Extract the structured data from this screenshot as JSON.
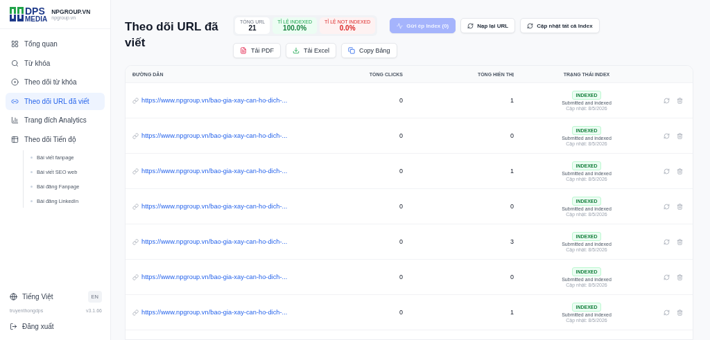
{
  "brand": {
    "logo_top": "DPS",
    "logo_bottom": "MEDIA",
    "name": "NPGROUP.VN",
    "domain": "npgroup.vn"
  },
  "nav": [
    {
      "label": "Tổng quan",
      "selected": false
    },
    {
      "label": "Từ khóa",
      "selected": false
    },
    {
      "label": "Theo dõi từ khóa",
      "selected": false
    },
    {
      "label": "Theo dõi URL đã viết",
      "selected": true
    },
    {
      "label": "Trang đích Analytics",
      "selected": false
    },
    {
      "label": "Theo dõi Tiến độ",
      "selected": false,
      "children": [
        {
          "label": "Bài viết fanpage"
        },
        {
          "label": "Bài viết SEO web"
        },
        {
          "label": "Bài đăng Fanpage"
        },
        {
          "label": "Bài đăng LinkedIn"
        }
      ]
    }
  ],
  "language": {
    "label": "Tiếng Việt",
    "switch": "EN"
  },
  "user": {
    "name": "truyenthongdps",
    "version": "v3.1.66"
  },
  "logout": "Đăng xuất",
  "title": "Theo dõi URL đã viết",
  "stats": [
    {
      "label": "TỔNG URL",
      "value": "21",
      "kind": "neutral"
    },
    {
      "label": "TỈ LỆ INDEXED",
      "value": "100.0%",
      "kind": "good"
    },
    {
      "label": "TỈ LỆ NOT INDEXED",
      "value": "0.0%",
      "kind": "bad"
    }
  ],
  "actions": [
    {
      "label": "Gửi ép Index (0)",
      "disabled": true
    },
    {
      "label": "Nạp lại URL",
      "disabled": false
    },
    {
      "label": "Cập nhật tất cả Index",
      "disabled": false
    }
  ],
  "exports": [
    "Tải PDF",
    "Tải Excel",
    "Copy Bảng"
  ],
  "table": {
    "columns": [
      "ĐƯỜNG DẪN",
      "TỔNG CLICKS",
      "TỔNG HIỂN THỊ",
      "TRẠNG THÁI INDEX"
    ],
    "rows": [
      {
        "url": "https://www.npgroup.vn/bao-gia-xay-can-ho-dich-...",
        "clicks": "0",
        "impressions": "1",
        "status": "INDEXED",
        "detail": "Submitted and indexed",
        "updated": "Cập nhật: 8/5/2026"
      },
      {
        "url": "https://www.npgroup.vn/bao-gia-xay-can-ho-dich-...",
        "clicks": "0",
        "impressions": "0",
        "status": "INDEXED",
        "detail": "Submitted and indexed",
        "updated": "Cập nhật: 8/5/2026"
      },
      {
        "url": "https://www.npgroup.vn/bao-gia-xay-can-ho-dich-...",
        "clicks": "0",
        "impressions": "1",
        "status": "INDEXED",
        "detail": "Submitted and indexed",
        "updated": "Cập nhật: 8/5/2026"
      },
      {
        "url": "https://www.npgroup.vn/bao-gia-xay-can-ho-dich-...",
        "clicks": "0",
        "impressions": "0",
        "status": "INDEXED",
        "detail": "Submitted and indexed",
        "updated": "Cập nhật: 8/5/2026"
      },
      {
        "url": "https://www.npgroup.vn/bao-gia-xay-can-ho-dich-...",
        "clicks": "0",
        "impressions": "3",
        "status": "INDEXED",
        "detail": "Submitted and indexed",
        "updated": "Cập nhật: 8/5/2026"
      },
      {
        "url": "https://www.npgroup.vn/bao-gia-xay-can-ho-dich-...",
        "clicks": "0",
        "impressions": "0",
        "status": "INDEXED",
        "detail": "Submitted and indexed",
        "updated": "Cập nhật: 8/5/2026"
      },
      {
        "url": "https://www.npgroup.vn/bao-gia-xay-can-ho-dich-...",
        "clicks": "0",
        "impressions": "1",
        "status": "INDEXED",
        "detail": "Submitted and indexed",
        "updated": "Cập nhật: 8/5/2026"
      }
    ]
  }
}
